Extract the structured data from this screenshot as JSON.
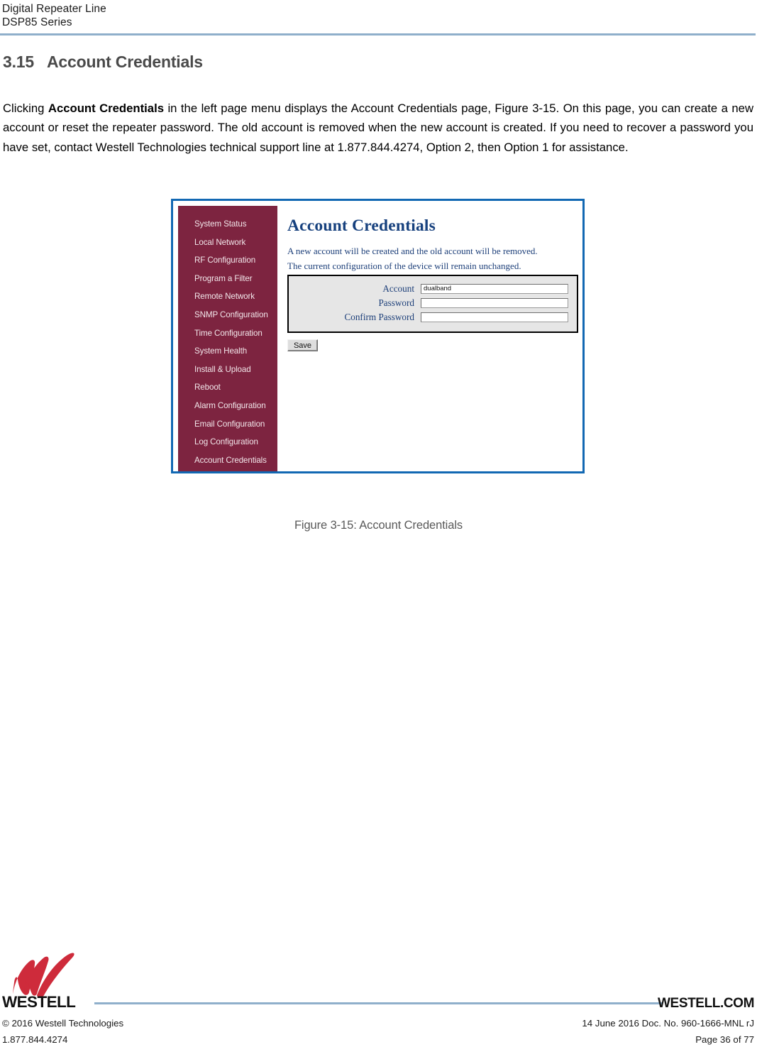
{
  "header": {
    "line1": "Digital Repeater Line",
    "line2": "DSP85 Series"
  },
  "section": {
    "number": "3.15",
    "title": "Account Credentials"
  },
  "paragraph": {
    "part1": "Clicking ",
    "bold1": "Account Credentials",
    "part2": " in the left page menu displays the Account Credentials page, Figure 3-15. On this page, you can create a new account or reset the repeater password.  The old account is removed when the new account is created.  If you need to recover a password you have set, contact Westell Technologies technical support line at 1.877.844.4274, Option 2, then Option 1 for assistance."
  },
  "figure": {
    "caption": "Figure 3-15: Account Credentials",
    "border_color": "#1268B3",
    "screenshot": {
      "sidebar": {
        "background_color": "#7D2440",
        "items": [
          {
            "label": "System Status"
          },
          {
            "label": "Local Network"
          },
          {
            "label": "RF Configuration"
          },
          {
            "label": "Program a Filter"
          },
          {
            "label": "Remote Network"
          },
          {
            "label": "SNMP Configuration"
          },
          {
            "label": "Time Configuration"
          },
          {
            "label": "System Health"
          },
          {
            "label": "Install & Upload"
          },
          {
            "label": "Reboot"
          },
          {
            "label": "Alarm Configuration"
          },
          {
            "label": "Email Configuration"
          },
          {
            "label": "Log Configuration"
          },
          {
            "label": "Account Credentials"
          }
        ]
      },
      "main": {
        "title": "Account Credentials",
        "title_color": "#17417E",
        "description_line1": "A new account will be created and the old account will be removed.",
        "description_line2": "The current configuration of the device will remain unchanged.",
        "fields": [
          {
            "label": "Account",
            "value": "dualband",
            "type": "text"
          },
          {
            "label": "Password",
            "value": "",
            "type": "password"
          },
          {
            "label": "Confirm Password",
            "value": "",
            "type": "password"
          }
        ],
        "save_label": "Save"
      }
    }
  },
  "footer": {
    "wordmark": "WESTELL",
    "website": "WESTELL.COM",
    "left_line1": "© 2016 Westell Technologies",
    "left_line2": "1.877.844.4274",
    "right_line1": "14 June 2016 Doc. No. 960-1666-MNL rJ",
    "right_line2": "Page 36 of 77",
    "logo_color": "#CE2B3B"
  }
}
